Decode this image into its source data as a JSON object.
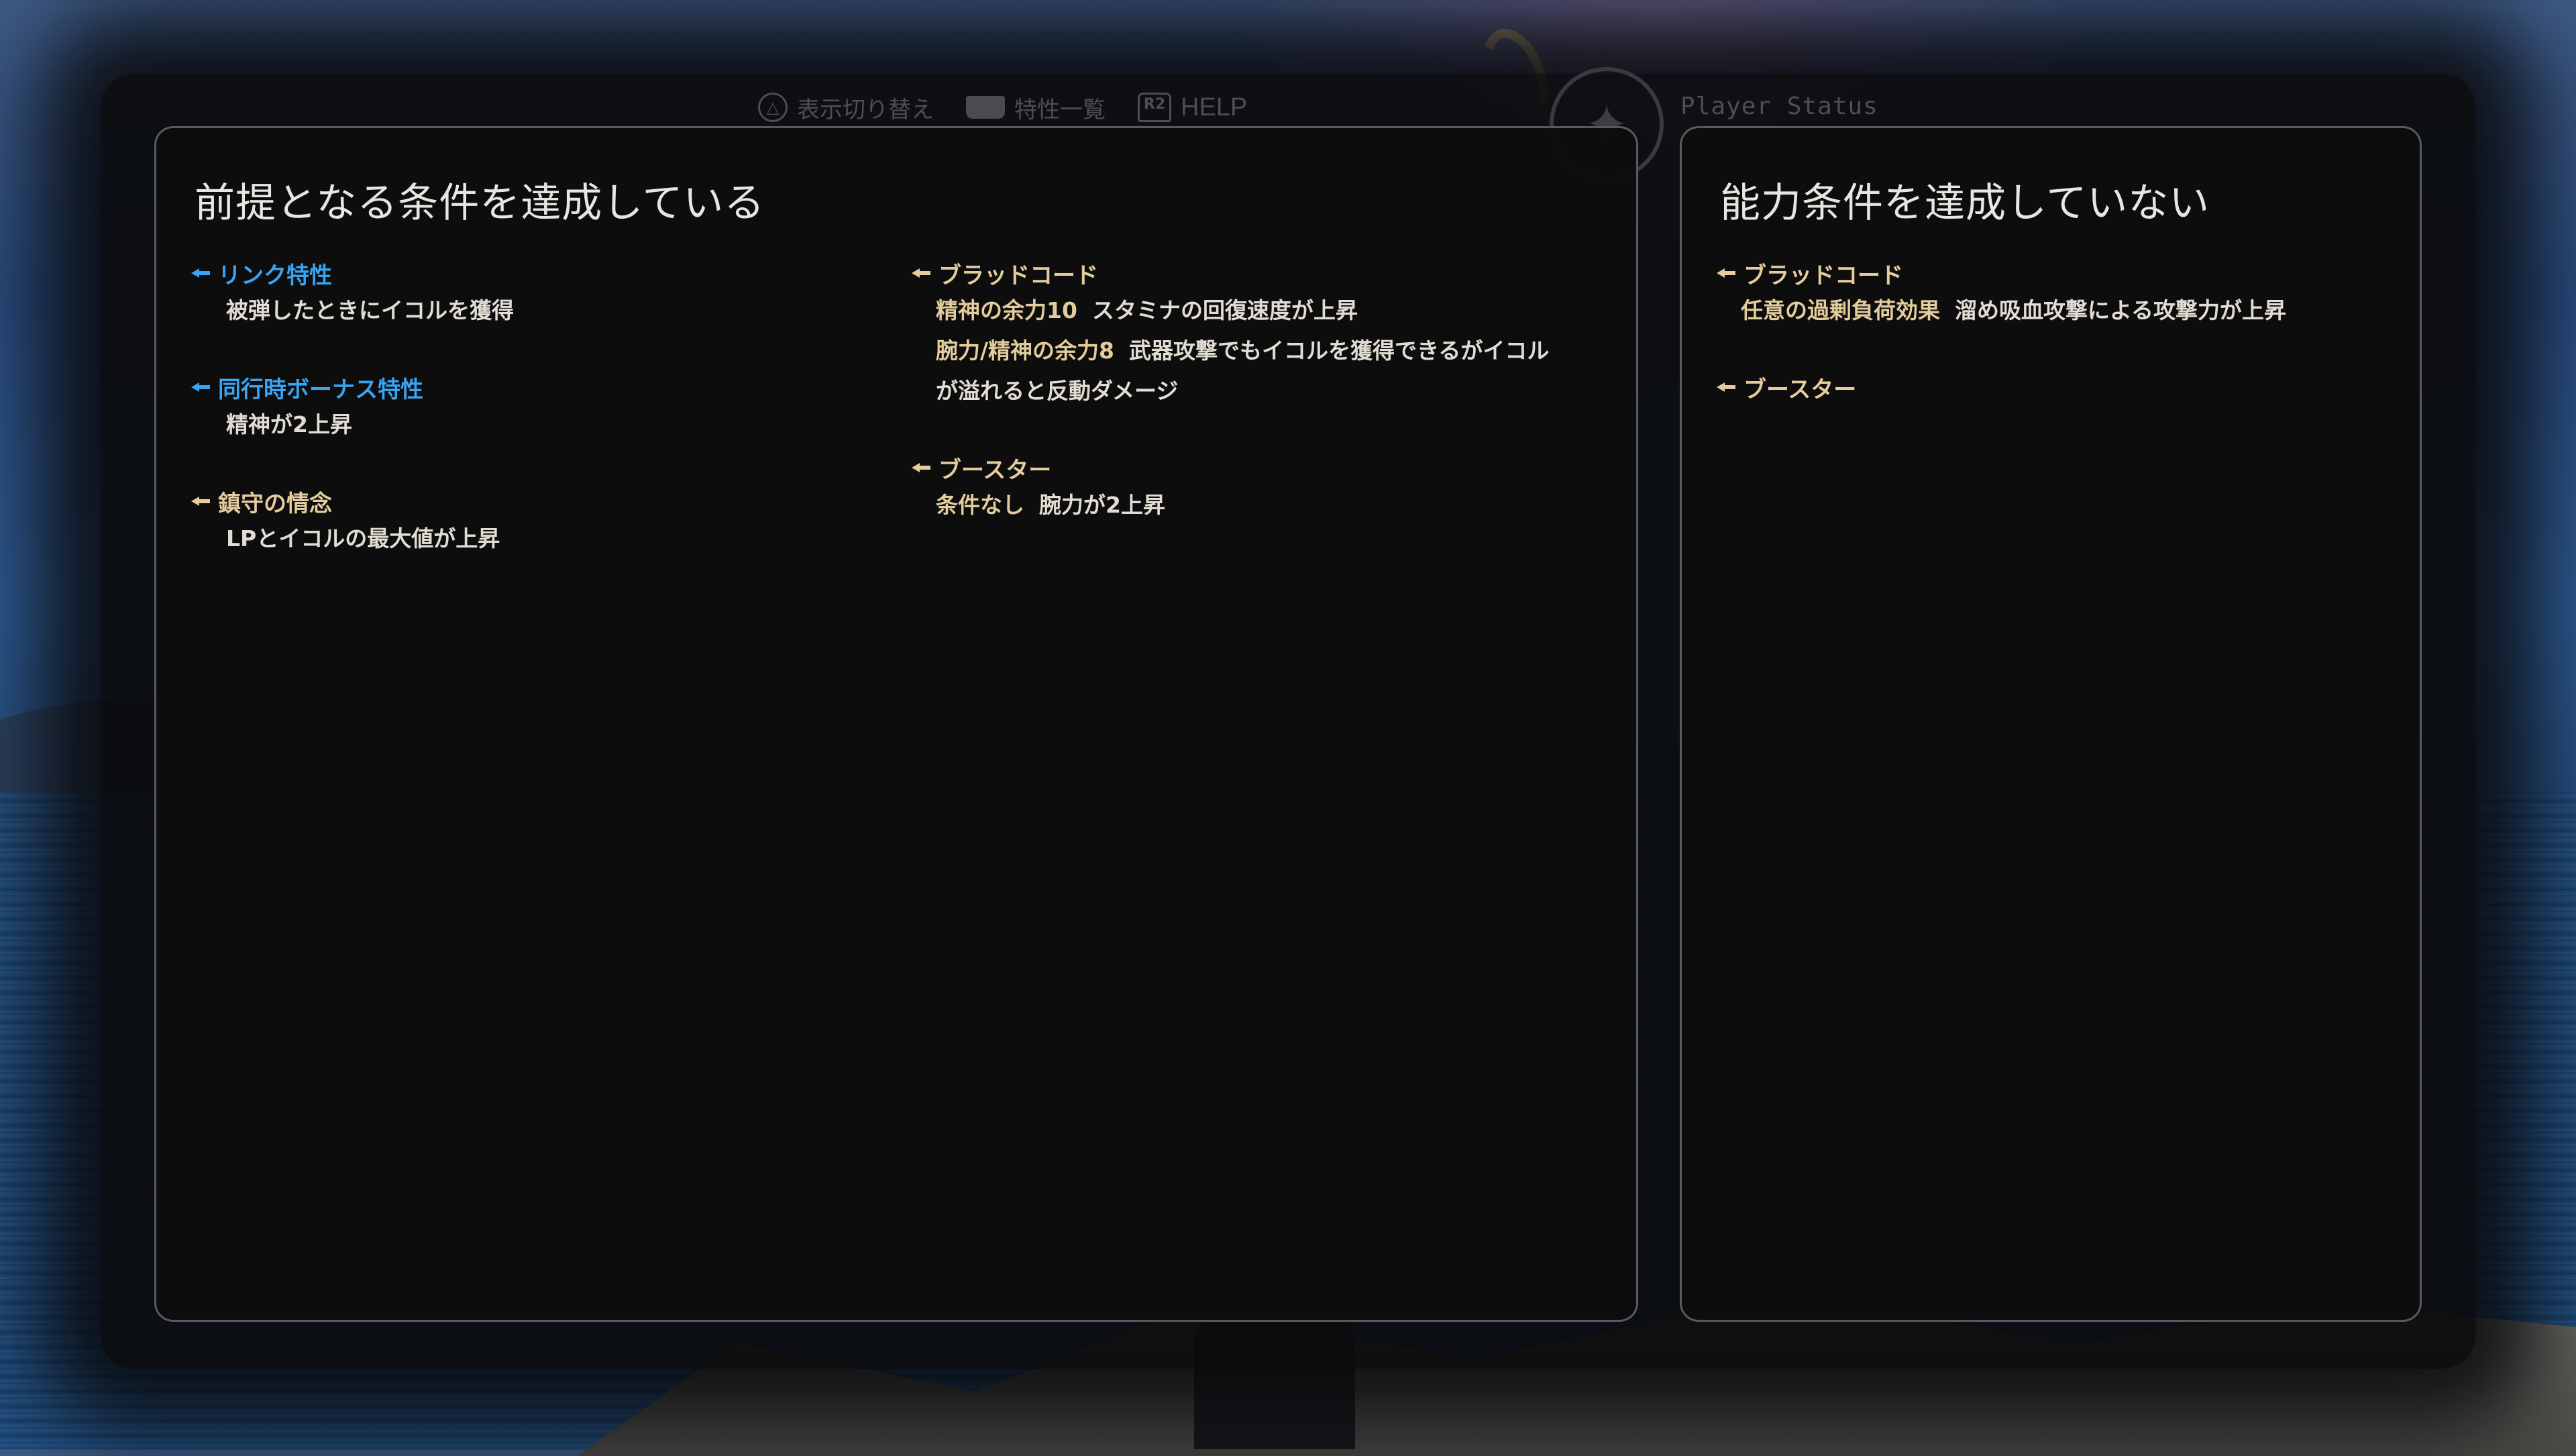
{
  "topbar": {
    "toggle_label": "表示切り替え",
    "toggle_icon": "triangle-button-icon",
    "traits_label": "特性一覧",
    "traits_icon": "touchpad-icon",
    "help_button": "R2",
    "help_label": "HELP",
    "status_title": "Player Status"
  },
  "left_panel": {
    "title": "前提となる条件を達成している",
    "entries": [
      {
        "name": "リンク特性",
        "color": "#3aa4f0",
        "lines": [
          {
            "text": "被弾したときにイコルを獲得"
          }
        ]
      },
      {
        "name": "同行時ボーナス特性",
        "color": "#3aa4f0",
        "lines": [
          {
            "text": "精神が2上昇"
          }
        ]
      },
      {
        "name": "鎮守の情念",
        "color": "#e4cc9c",
        "lines": [
          {
            "text": "LPとイコルの最大値が上昇"
          }
        ]
      },
      {
        "name": "ブラッドコード",
        "color": "#e4cc9c",
        "lines": [
          {
            "cond": "精神の余力10",
            "effect": "スタミナの回復速度が上昇"
          },
          {
            "cond": "腕力/精神の余力8",
            "effect": "武器攻撃でもイコルを獲得できるがイコル"
          },
          {
            "effect": "が溢れると反動ダメージ"
          }
        ]
      },
      {
        "name": "ブースター",
        "color": "#e4cc9c",
        "lines": [
          {
            "cond": "条件なし",
            "effect": "腕力が2上昇"
          }
        ]
      }
    ]
  },
  "right_panel": {
    "title": "能力条件を達成していない",
    "entries": [
      {
        "name": "ブラッドコード",
        "color": "#e4cc9c",
        "lines": [
          {
            "cond": "任意の過剰負荷効果",
            "effect": "溜め吸血攻撃による攻撃力が上昇"
          }
        ]
      },
      {
        "name": "ブースター",
        "color": "#e4cc9c",
        "lines": []
      }
    ]
  }
}
